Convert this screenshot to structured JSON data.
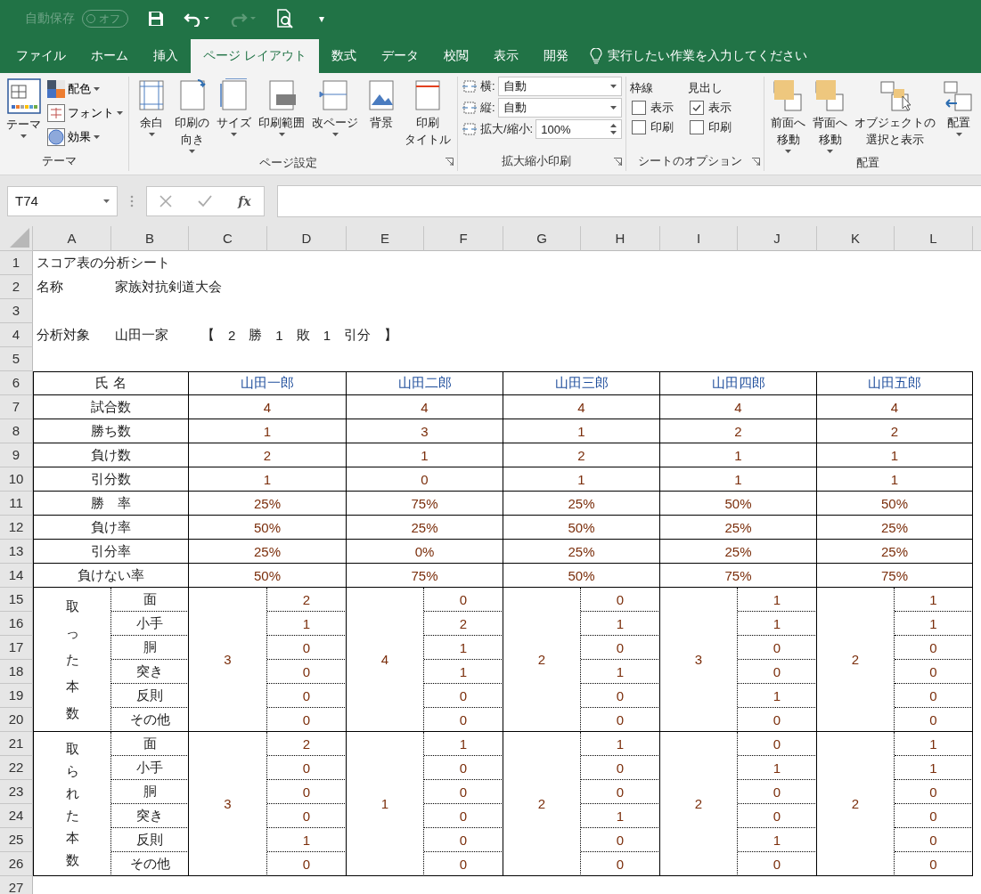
{
  "title_bar": {
    "autosave": {
      "label": "自動保存",
      "state": "オフ",
      "on": false
    },
    "customize_caret": "▾"
  },
  "tabs": [
    {
      "label": "ファイル",
      "selected": false
    },
    {
      "label": "ホーム",
      "selected": false
    },
    {
      "label": "挿入",
      "selected": false
    },
    {
      "label": "ページ レイアウト",
      "selected": true
    },
    {
      "label": "数式",
      "selected": false
    },
    {
      "label": "データ",
      "selected": false
    },
    {
      "label": "校閲",
      "selected": false
    },
    {
      "label": "表示",
      "selected": false
    },
    {
      "label": "開発",
      "selected": false
    }
  ],
  "search": {
    "placeholder": "実行したい作業を入力してください"
  },
  "ribbon": {
    "theme_group": {
      "label": "テーマ",
      "big_button": {
        "label": "テーマ",
        "dropdown": true
      },
      "small_buttons": [
        {
          "label": "配色",
          "dropdown": true
        },
        {
          "label": "フォント",
          "dropdown": true
        },
        {
          "label": "効果",
          "dropdown": true
        }
      ]
    },
    "page_setup_group": {
      "label": "ページ設定",
      "buttons": [
        {
          "lines": [
            "余白"
          ],
          "dropdown": true
        },
        {
          "lines": [
            "印刷の",
            "向き"
          ],
          "dropdown": true
        },
        {
          "lines": [
            "サイズ"
          ],
          "dropdown": true
        },
        {
          "lines": [
            "印刷範囲"
          ],
          "dropdown": true
        },
        {
          "lines": [
            "改ページ"
          ],
          "dropdown": true
        },
        {
          "lines": [
            "背景"
          ],
          "dropdown": false
        },
        {
          "lines": [
            "印刷",
            "タイトル"
          ],
          "dropdown": false
        }
      ]
    },
    "scale_group": {
      "label": "拡大縮小印刷",
      "fields": [
        {
          "label": "横:",
          "value": "自動",
          "kind": "dropdown"
        },
        {
          "label": "縦:",
          "value": "自動",
          "kind": "dropdown"
        },
        {
          "label": "拡大/縮小:",
          "value": "100%",
          "kind": "spinner"
        }
      ]
    },
    "sheet_options_group": {
      "label": "シートのオプション",
      "columns": [
        {
          "title": "枠線",
          "options": [
            {
              "label": "表示",
              "checked": false
            },
            {
              "label": "印刷",
              "checked": false
            }
          ]
        },
        {
          "title": "見出し",
          "options": [
            {
              "label": "表示",
              "checked": true
            },
            {
              "label": "印刷",
              "checked": false
            }
          ]
        }
      ]
    },
    "arrange_group": {
      "label": "配置",
      "buttons": [
        {
          "lines": [
            "前面へ",
            "移動"
          ],
          "dropdown": true
        },
        {
          "lines": [
            "背面へ",
            "移動"
          ],
          "dropdown": true
        },
        {
          "lines": [
            "オブジェクトの",
            "選択と表示"
          ],
          "dropdown": false
        },
        {
          "lines": [
            "配置"
          ],
          "dropdown": true
        }
      ]
    }
  },
  "formula_bar": {
    "name_box": "T74",
    "function_label": "fx"
  },
  "sheet": {
    "columns": [
      "A",
      "B",
      "C",
      "D",
      "E",
      "F",
      "G",
      "H",
      "I",
      "J",
      "K",
      "L"
    ],
    "rows": [
      "1",
      "2",
      "3",
      "4",
      "5",
      "6",
      "7",
      "8",
      "9",
      "10",
      "11",
      "12",
      "13",
      "14",
      "15",
      "16",
      "17",
      "18",
      "19",
      "20",
      "21",
      "22",
      "23",
      "24",
      "25",
      "26",
      "27"
    ],
    "title": "スコア表の分析シート",
    "name_label": "名称",
    "name_value": "家族対抗剣道大会",
    "target_label": "分析対象",
    "target_value": "山田一家",
    "record_parts": [
      "【",
      "2",
      "勝",
      "1",
      "敗",
      "1",
      "引分",
      "】"
    ],
    "table": {
      "header_label": "氏 名",
      "players": [
        "山田一郎",
        "山田二郎",
        "山田三郎",
        "山田四郎",
        "山田五郎"
      ],
      "stats": [
        {
          "label": "試合数",
          "values": [
            "4",
            "4",
            "4",
            "4",
            "4"
          ]
        },
        {
          "label": "勝ち数",
          "values": [
            "1",
            "3",
            "1",
            "2",
            "2"
          ]
        },
        {
          "label": "負け数",
          "values": [
            "2",
            "1",
            "2",
            "1",
            "1"
          ]
        },
        {
          "label": "引分数",
          "values": [
            "1",
            "0",
            "1",
            "1",
            "1"
          ]
        },
        {
          "label": "勝　率",
          "values": [
            "25%",
            "75%",
            "25%",
            "50%",
            "50%"
          ]
        },
        {
          "label": "負け率",
          "values": [
            "50%",
            "25%",
            "50%",
            "25%",
            "25%"
          ]
        },
        {
          "label": "引分率",
          "values": [
            "25%",
            "0%",
            "25%",
            "25%",
            "25%"
          ]
        },
        {
          "label": "負けない率",
          "values": [
            "50%",
            "75%",
            "50%",
            "75%",
            "75%"
          ]
        }
      ],
      "sections": [
        {
          "label": "取った本数",
          "totals": [
            "3",
            "4",
            "2",
            "3",
            "2"
          ],
          "rows": [
            {
              "label": "面",
              "values": [
                "2",
                "0",
                "0",
                "1",
                "1"
              ]
            },
            {
              "label": "小手",
              "values": [
                "1",
                "2",
                "1",
                "1",
                "1"
              ]
            },
            {
              "label": "胴",
              "values": [
                "0",
                "1",
                "0",
                "0",
                "0"
              ]
            },
            {
              "label": "突き",
              "values": [
                "0",
                "1",
                "1",
                "0",
                "0"
              ]
            },
            {
              "label": "反則",
              "values": [
                "0",
                "0",
                "0",
                "1",
                "0"
              ]
            },
            {
              "label": "その他",
              "values": [
                "0",
                "0",
                "0",
                "0",
                "0"
              ]
            }
          ]
        },
        {
          "label": "取られた本数",
          "totals": [
            "3",
            "1",
            "2",
            "2",
            "2"
          ],
          "rows": [
            {
              "label": "面",
              "values": [
                "2",
                "1",
                "1",
                "0",
                "1"
              ]
            },
            {
              "label": "小手",
              "values": [
                "0",
                "0",
                "0",
                "1",
                "1"
              ]
            },
            {
              "label": "胴",
              "values": [
                "0",
                "0",
                "0",
                "0",
                "0"
              ]
            },
            {
              "label": "突き",
              "values": [
                "0",
                "0",
                "1",
                "0",
                "0"
              ]
            },
            {
              "label": "反則",
              "values": [
                "1",
                "0",
                "0",
                "1",
                "0"
              ]
            },
            {
              "label": "その他",
              "values": [
                "0",
                "0",
                "0",
                "0",
                "0"
              ]
            }
          ]
        }
      ]
    }
  }
}
